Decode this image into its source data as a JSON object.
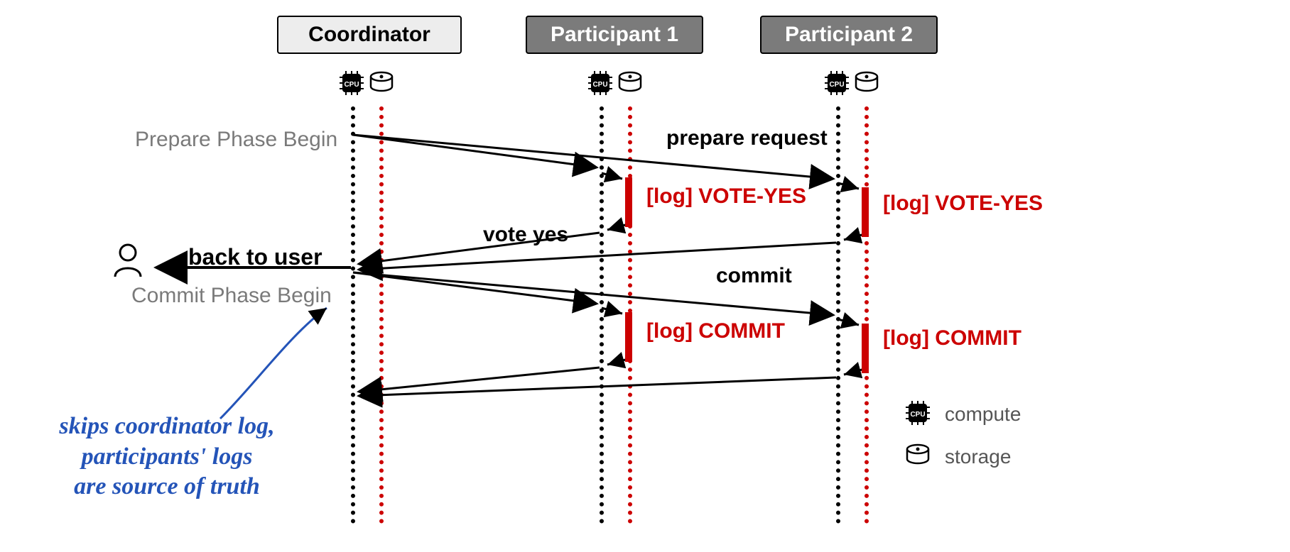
{
  "actors": {
    "coordinator": "Coordinator",
    "participant1": "Participant 1",
    "participant2": "Participant 2"
  },
  "phases": {
    "prepare_begin": "Prepare Phase Begin",
    "commit_begin": "Commit Phase Begin"
  },
  "messages": {
    "prepare_request": "prepare request",
    "vote_yes": "vote yes",
    "commit": "commit",
    "back_to_user": "back to user"
  },
  "logs": {
    "vote_yes": "[log] VOTE-YES",
    "commit": "[log] COMMIT"
  },
  "legend": {
    "compute": "compute",
    "storage": "storage"
  },
  "annotation": "skips coordinator log,<br>participants' logs<br>are source of truth",
  "icons": {
    "cpu_label": "CPU"
  }
}
